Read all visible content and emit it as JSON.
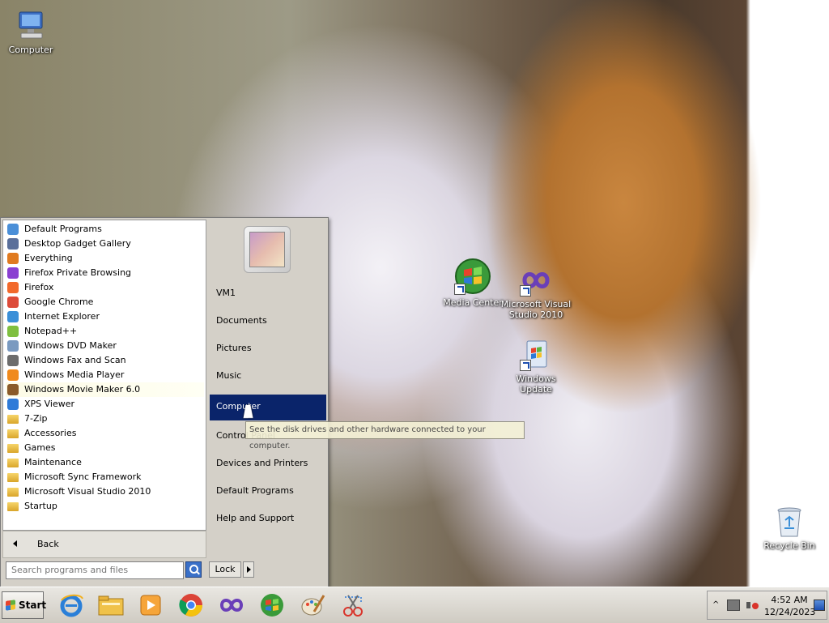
{
  "desktop": {
    "icons": {
      "computer": "Computer",
      "media_center": "Media Center",
      "visual_studio": "Microsoft Visual Studio 2010",
      "windows_update": "Windows Update",
      "recycle_bin": "Recycle Bin"
    }
  },
  "start_menu": {
    "programs": [
      {
        "label": "Default Programs",
        "icon": "default-programs-icon",
        "color": "#4a8fd8"
      },
      {
        "label": "Desktop Gadget Gallery",
        "icon": "gadget-gallery-icon",
        "color": "#5a6f9a"
      },
      {
        "label": "Everything",
        "icon": "everything-search-icon",
        "color": "#e07a1f"
      },
      {
        "label": "Firefox Private Browsing",
        "icon": "firefox-private-icon",
        "color": "#8a3fd1"
      },
      {
        "label": "Firefox",
        "icon": "firefox-icon",
        "color": "#f2692b"
      },
      {
        "label": "Google Chrome",
        "icon": "chrome-icon",
        "color": "#dd4b39"
      },
      {
        "label": "Internet Explorer",
        "icon": "internet-explorer-icon",
        "color": "#3a8fd8"
      },
      {
        "label": "Notepad++",
        "icon": "notepad-plus-icon",
        "color": "#7fbf3f"
      },
      {
        "label": "Windows DVD Maker",
        "icon": "dvd-maker-icon",
        "color": "#7a9ac0"
      },
      {
        "label": "Windows Fax and Scan",
        "icon": "fax-scan-icon",
        "color": "#6c6c6c"
      },
      {
        "label": "Windows Media Player",
        "icon": "media-player-icon",
        "color": "#f08a1d"
      },
      {
        "label": "Windows Movie Maker 6.0",
        "icon": "movie-maker-icon",
        "color": "#8a5a2a"
      },
      {
        "label": "XPS Viewer",
        "icon": "xps-viewer-icon",
        "color": "#2e7ad8"
      },
      {
        "label": "7-Zip",
        "icon": "folder-icon",
        "color": "#e8b83a"
      },
      {
        "label": "Accessories",
        "icon": "folder-icon",
        "color": "#e8b83a"
      },
      {
        "label": "Games",
        "icon": "folder-icon",
        "color": "#e8b83a"
      },
      {
        "label": "Maintenance",
        "icon": "folder-icon",
        "color": "#e8b83a"
      },
      {
        "label": "Microsoft Sync Framework",
        "icon": "folder-icon",
        "color": "#e8b83a"
      },
      {
        "label": "Microsoft Visual Studio 2010",
        "icon": "folder-icon",
        "color": "#e8b83a"
      },
      {
        "label": "Startup",
        "icon": "folder-icon",
        "color": "#e8b83a"
      }
    ],
    "highlighted_program": "Windows Movie Maker 6.0",
    "back_label": "Back",
    "search": {
      "placeholder": "Search programs and files",
      "value": ""
    },
    "right_items": [
      "VM1",
      "Documents",
      "Pictures",
      "Music",
      "Computer",
      "Control Panel",
      "Devices and Printers",
      "Default Programs",
      "Help and Support"
    ],
    "selected_right_item": "Computer",
    "lock_label": "Lock",
    "tooltip": "See the disk drives and other hardware connected to your computer."
  },
  "taskbar": {
    "start_label": "Start",
    "pinned": [
      "internet-explorer-icon",
      "file-explorer-icon",
      "media-player-icon",
      "chrome-icon",
      "visual-studio-icon",
      "media-center-icon",
      "paint-icon",
      "snipping-tool-icon"
    ],
    "clock": {
      "time": "4:52 AM",
      "date": "12/24/2023"
    },
    "tray_chevron": "^"
  },
  "colors": {
    "selection": "#0a246a",
    "menu_bg": "#d4d0c8",
    "taskbar": "#d6d2c9"
  }
}
